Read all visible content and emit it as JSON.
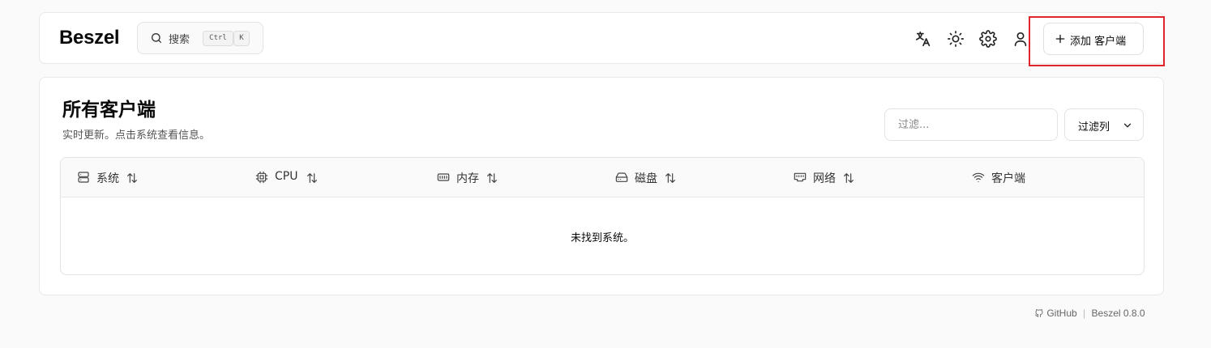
{
  "header": {
    "logo": "Beszel",
    "search": {
      "label": "搜索",
      "kbd_ctrl": "Ctrl",
      "kbd_k": "K"
    },
    "add_client_label": "添加 客户端"
  },
  "main": {
    "title": "所有客户端",
    "subtitle": "实时更新。点击系统查看信息。",
    "filter_placeholder": "过滤...",
    "columns_button": "过滤列",
    "table": {
      "columns": [
        {
          "label": "系统",
          "icon": "server-icon",
          "sortable": true
        },
        {
          "label": "CPU",
          "icon": "cpu-icon",
          "sortable": true
        },
        {
          "label": "内存",
          "icon": "memory-icon",
          "sortable": true
        },
        {
          "label": "磁盘",
          "icon": "hard-drive-icon",
          "sortable": true
        },
        {
          "label": "网络",
          "icon": "network-icon",
          "sortable": true
        },
        {
          "label": "客户端",
          "icon": "wifi-icon",
          "sortable": false
        }
      ],
      "empty_message": "未找到系统。"
    }
  },
  "footer": {
    "github": "GitHub",
    "separator": "|",
    "version": "Beszel 0.8.0"
  },
  "colors": {
    "highlight_border": "#e0262b",
    "background": "#fafafa",
    "card": "#ffffff"
  }
}
